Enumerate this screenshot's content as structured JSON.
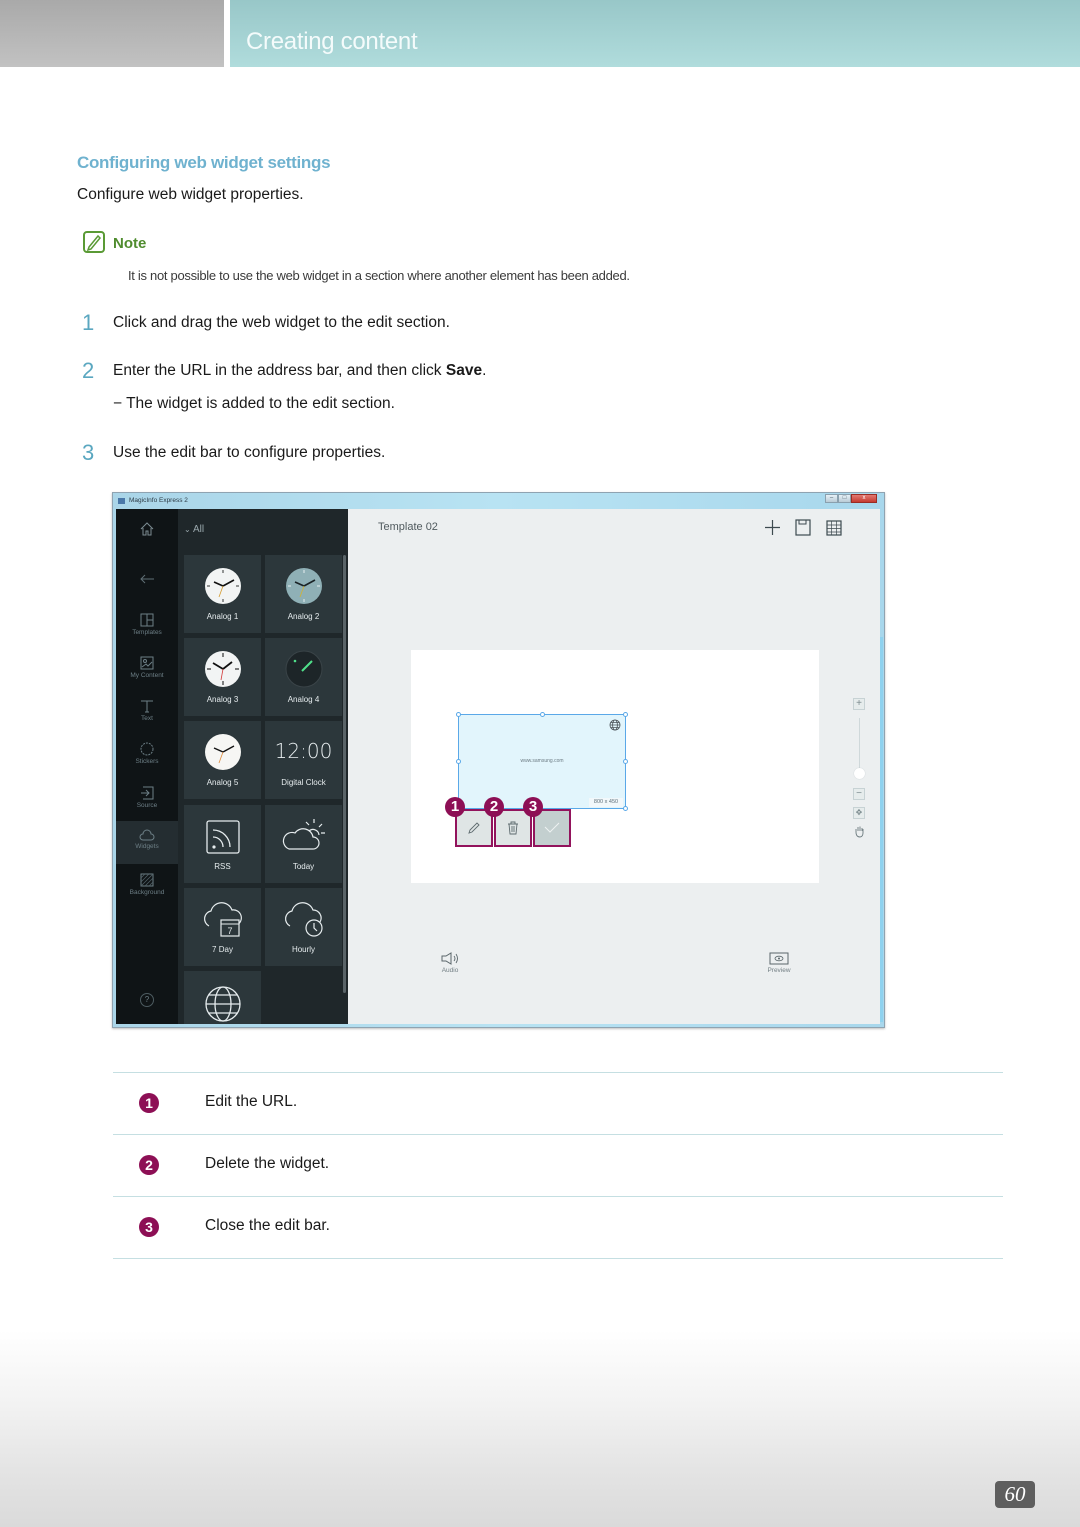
{
  "header": {
    "section_title": "Creating content"
  },
  "section": {
    "title": "Configuring web widget settings",
    "description": "Configure web widget properties."
  },
  "note": {
    "label": "Note",
    "text": "It is not possible to use the web widget in a section where another element has been added."
  },
  "steps": [
    {
      "number": "1",
      "text": "Click and drag the web widget to the edit section."
    },
    {
      "number": "2",
      "text_before": "Enter the URL in the address bar, and then click ",
      "text_bold": "Save",
      "text_after": ".",
      "sub": "−  The widget is added to the edit section."
    },
    {
      "number": "3",
      "text": "Use the edit bar to configure properties."
    }
  ],
  "app": {
    "window_title": "MagicInfo Express 2",
    "window_buttons": {
      "minimize": "–",
      "maximize": "□",
      "close": "x"
    },
    "rail": {
      "items": [
        {
          "label": "",
          "icon": "home-icon"
        },
        {
          "label": "",
          "icon": "back-arrow-icon"
        },
        {
          "label": "Templates",
          "icon": "templates-icon"
        },
        {
          "label": "My Content",
          "icon": "image-icon"
        },
        {
          "label": "Text",
          "icon": "text-icon"
        },
        {
          "label": "Stickers",
          "icon": "sticker-icon"
        },
        {
          "label": "Source",
          "icon": "source-icon"
        },
        {
          "label": "Widgets",
          "icon": "cloud-icon",
          "active": true
        },
        {
          "label": "Background",
          "icon": "background-icon"
        }
      ],
      "help_label": "?"
    },
    "panel": {
      "filter_label": "All",
      "widgets": [
        {
          "label": "Analog 1",
          "icon": "analog-clock-icon"
        },
        {
          "label": "Analog 2",
          "icon": "analog-clock-icon"
        },
        {
          "label": "Analog 3",
          "icon": "analog-clock-icon"
        },
        {
          "label": "Analog 4",
          "icon": "analog-clock-icon"
        },
        {
          "label": "Analog 5",
          "icon": "analog-clock-icon"
        },
        {
          "label": "Digital Clock",
          "icon": "digital-clock-icon",
          "display": "12:00"
        },
        {
          "label": "RSS",
          "icon": "rss-icon"
        },
        {
          "label": "Today",
          "icon": "weather-today-icon"
        },
        {
          "label": "7 Day",
          "icon": "weather-7day-icon",
          "badge": "7"
        },
        {
          "label": "Hourly",
          "icon": "weather-hourly-icon"
        },
        {
          "label": "",
          "icon": "globe-icon"
        }
      ]
    },
    "main": {
      "template_name": "Template 02",
      "toolbar": [
        "add-icon",
        "save-icon",
        "schedule-icon"
      ],
      "widget": {
        "url": "www.samsung.com",
        "size": "800 x 450"
      },
      "edit_bar": [
        {
          "callout": "1",
          "icon": "pencil-icon",
          "action": "edit-url"
        },
        {
          "callout": "2",
          "icon": "trash-icon",
          "action": "delete-widget"
        },
        {
          "callout": "3",
          "icon": "check-icon",
          "action": "close-edit-bar"
        }
      ],
      "zoom_controls": {
        "plus": "+",
        "minus": "−",
        "fit": "✥",
        "pan": "hand-icon"
      },
      "bottom": {
        "audio_label": "Audio",
        "preview_label": "Preview"
      }
    }
  },
  "legend": [
    {
      "number": "1",
      "text": "Edit the URL."
    },
    {
      "number": "2",
      "text": "Delete the widget."
    },
    {
      "number": "3",
      "text": "Close the edit bar."
    }
  ],
  "page_number": "60",
  "colors": {
    "header_teal": "#a8d6d7",
    "section_title": "#6fb2cf",
    "note_green": "#4f8c2e",
    "step_number": "#5aa7c0",
    "callout_magenta": "#8d0f55"
  }
}
